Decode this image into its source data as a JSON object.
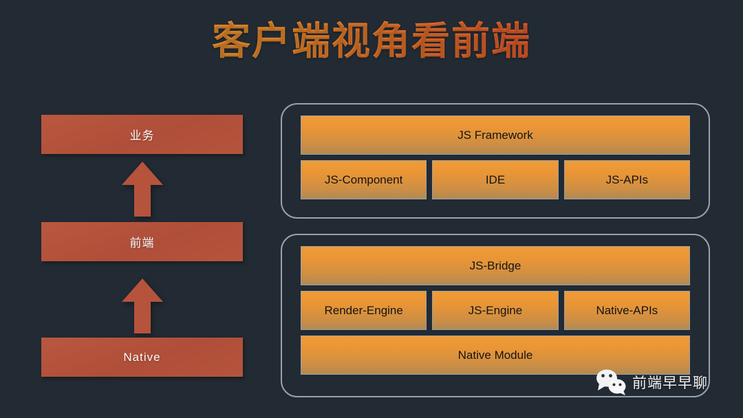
{
  "slide": {
    "title": "客户端视角看前端",
    "background_color": "#222a33",
    "title_gradient_from": "#f0a132",
    "title_gradient_to": "#e8402a"
  },
  "left_stack": {
    "box_color": "#b6533c",
    "boxes": [
      {
        "label": "业务"
      },
      {
        "label": "前端"
      },
      {
        "label": "Native"
      }
    ],
    "arrows": [
      {
        "name": "arrow-up-native-to-frontend"
      },
      {
        "name": "arrow-up-frontend-to-business"
      }
    ]
  },
  "right_panel": {
    "cell_color": "#ef9c36",
    "border_color": "#9aa2ab",
    "groups": [
      {
        "name": "js-layer-group",
        "rows": [
          {
            "cells": [
              {
                "label": "JS Framework"
              }
            ]
          },
          {
            "cells": [
              {
                "label": "JS-Component"
              },
              {
                "label": "IDE"
              },
              {
                "label": "JS-APIs"
              }
            ]
          }
        ]
      },
      {
        "name": "native-layer-group",
        "rows": [
          {
            "cells": [
              {
                "label": "JS-Bridge"
              }
            ]
          },
          {
            "cells": [
              {
                "label": "Render-Engine"
              },
              {
                "label": "JS-Engine"
              },
              {
                "label": "Native-APIs"
              }
            ]
          },
          {
            "cells": [
              {
                "label": "Native Module"
              }
            ]
          }
        ]
      }
    ]
  },
  "watermark": {
    "icon": "wechat-icon",
    "label": "前端早早聊"
  }
}
